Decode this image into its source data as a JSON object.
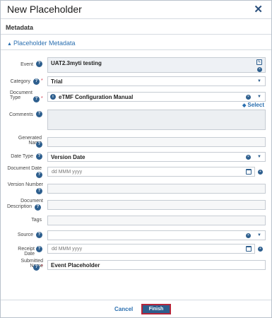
{
  "dialog": {
    "title": "New Placeholder",
    "close_glyph": "✕"
  },
  "section": {
    "title": "Metadata"
  },
  "subsection": {
    "title": "Placeholder Metadata"
  },
  "fields": {
    "event": {
      "label": "Event",
      "value": "UAT2.3myti testing"
    },
    "category": {
      "label": "Category",
      "value": "Trial"
    },
    "document_type": {
      "label": "Document Type",
      "value": "eTMF Configuration Manual",
      "select_label": "Select"
    },
    "comments": {
      "label": "Comments",
      "value": ""
    },
    "generated_name": {
      "label": "Generated Name",
      "value": ""
    },
    "date_type": {
      "label": "Date Type",
      "value": "Version Date"
    },
    "document_date": {
      "label": "Document Date",
      "placeholder": "dd MMM yyyy"
    },
    "version_number": {
      "label": "Version Number",
      "value": ""
    },
    "document_description": {
      "label_line1": "Document",
      "label_line2": "Description",
      "value": ""
    },
    "tags": {
      "label": "Tags",
      "value": ""
    },
    "source": {
      "label": "Source",
      "value": ""
    },
    "receipt_date": {
      "label": "Receipt Date",
      "placeholder": "dd MMM yyyy"
    },
    "submitted_name": {
      "label": "Submitted Name",
      "value": "Event Placeholder"
    }
  },
  "footer": {
    "cancel_label": "Cancel",
    "finish_label": "Finish"
  },
  "colors": {
    "accent": "#2e5f8e",
    "link": "#2a6fb0",
    "required": "#d0344b",
    "finish_border": "#b5253a"
  }
}
